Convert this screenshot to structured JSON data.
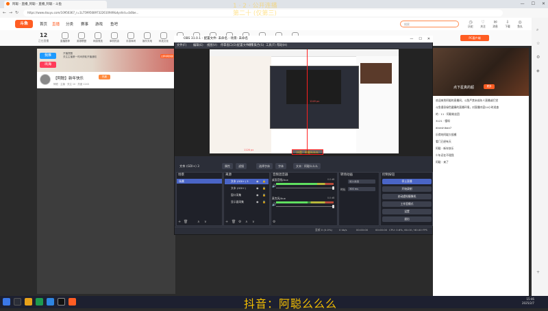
{
  "browser": {
    "tab_title": "阿聪 - 直播_阿聪 - 直播_阿聪 - 斗鱼",
    "url": "https://www.douyu.com/10956367_r=1L759956897322610949&dyshid=cb0be..."
  },
  "watermark": {
    "line1": "1 · 2 · 公开连播",
    "line2": "第二十 (仅第三)"
  },
  "site": {
    "logo": "斗鱼",
    "nav": [
      "首页",
      "直播",
      "分类",
      "赛事",
      "游戏",
      "鱼吧"
    ],
    "search_placeholder": "搜索",
    "top_right": [
      "历史",
      "关注",
      "消息",
      "下载",
      "鱼丸",
      "开播"
    ],
    "follow_count": "12",
    "follow_label": "正在直播",
    "categories": [
      "直播推荐",
      "英雄联盟",
      "网游竞技",
      "单机热游",
      "手游休闲",
      "娱乐天地",
      "科技文化",
      "户外",
      "语音直播",
      "颜值",
      "二次元",
      "体育",
      "纪录片",
      "文娱课堂",
      "正能量"
    ],
    "pc_client": "PC客户端"
  },
  "promo": {
    "badge1": "我推",
    "badge2": "出海",
    "text_line1": "开播提醒",
    "text_line2": "关注主播第一时间获取开播通知",
    "button": "立即领取奖励"
  },
  "room": {
    "title": "【阿聪】新年快乐",
    "hot": "热度",
    "meta": "阿聪 · 主播 · 关注 10 · 热度 1243"
  },
  "right_banner": {
    "text": "点下星真的超",
    "badge": "更多"
  },
  "chat": [
    "欢迎来到阿聪的直播间，斗鱼严禁未成年人直播或打赏",
    "斗鱼倡导绿色健康的直播环境，对直播内容24小时巡查",
    "的 · 11 · 阿聪粉丝团",
    "3121 · 懂呀",
    "dianshibaa7",
    "乐得的阿聪大规模",
    "看门已经有天",
    "阿聪 · 新年快乐",
    "少年还在不理我",
    "阿聪 · 来了"
  ],
  "obs": {
    "title": "OBS 31.0.1 - 配置文件: 未命名 - 场景: 未命名",
    "menus": [
      "文件(F)",
      "编辑(E)",
      "视图(V)",
      "停靠窗口(D)",
      "配置文件(P)",
      "场景集合(S)",
      "工具(T)",
      "帮助(H)"
    ],
    "preview_label_a": "1126 px",
    "preview_label_b": "1249 px",
    "preview_caption": "抖音：阿聪么么么",
    "source_bar": {
      "name": "文本 (GDI+) 3",
      "props": "属性",
      "filters": "滤镜",
      "text_label": "字体",
      "text_value": "选择字体",
      "text_label2": "文本：阿聪么么么"
    },
    "docks": {
      "scenes": "场景",
      "sources": "来源",
      "mixer": "音频混音器",
      "transitions": "转场动画",
      "controls": "控制按钮"
    },
    "scene_items": [
      "场景"
    ],
    "sources": [
      "文本 (GDI+) 3",
      "文本 (GDI+)",
      "窗口采集",
      "显示器采集"
    ],
    "mixer": [
      {
        "label": "桌面音频/Aux",
        "db": "0.0 dB",
        "level": 0.72
      },
      {
        "label": "麦克风/Aux",
        "db": "0.0 dB",
        "level": 0.55
      }
    ],
    "transitions": {
      "type_value": "淡入淡出",
      "duration_label": "时长",
      "duration_value": "300 ms"
    },
    "controls": [
      "停止直播",
      "开始录制",
      "启动虚拟摄像机",
      "工作室模式",
      "设置",
      "退出"
    ],
    "status": {
      "dropped": "丢帧 0 (0.0%)",
      "kbps": "0 kb/s",
      "live_time": "00:00:00",
      "rec_time": "00:00:00",
      "cpu": "CPU: 0.6%, 60.00 / 60.00 FPS"
    }
  },
  "subtitle": "抖音：阿聪么么么",
  "taskbar": {
    "time": "15:46",
    "date": "2025/2/7"
  },
  "colors": {
    "brand": "#ff5d23",
    "obs_accent": "#4a65c6",
    "subtitle": "#f5c000"
  }
}
